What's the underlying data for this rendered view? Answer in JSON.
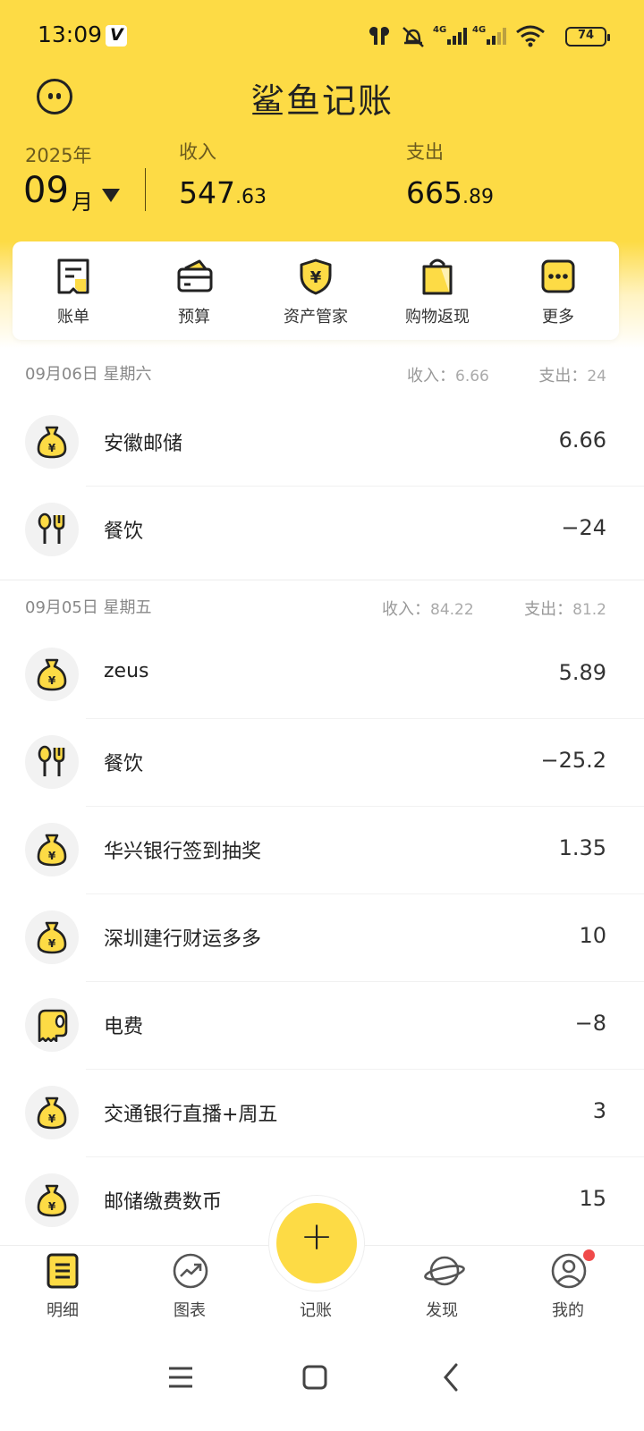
{
  "status_bar": {
    "time": "13:09",
    "app_badge": "V",
    "battery": "74"
  },
  "header": {
    "title": "鲨鱼记账",
    "year": "2025年",
    "month": "09",
    "month_unit": "月"
  },
  "summary": {
    "income_label": "收入",
    "income_int": "547",
    "income_dec": ".63",
    "expense_label": "支出",
    "expense_int": "665",
    "expense_dec": ".89"
  },
  "quick_menu": [
    {
      "label": "账单",
      "icon": "bill-icon"
    },
    {
      "label": "预算",
      "icon": "budget-wallet-icon"
    },
    {
      "label": "资产管家",
      "icon": "asset-shield-icon"
    },
    {
      "label": "购物返现",
      "icon": "shopping-bag-icon"
    },
    {
      "label": "更多",
      "icon": "more-icon"
    }
  ],
  "days": [
    {
      "date": "09月06日 星期六",
      "income_label": "收入：",
      "income": "6.66",
      "expense_label": "支出：",
      "expense": "24",
      "rows": [
        {
          "name": "安徽邮储",
          "amount": "6.66",
          "icon": "money-bag-icon"
        },
        {
          "name": "餐饮",
          "amount": "−24",
          "icon": "dining-icon"
        }
      ]
    },
    {
      "date": "09月05日 星期五",
      "income_label": "收入：",
      "income": "84.22",
      "expense_label": "支出：",
      "expense": "81.2",
      "rows": [
        {
          "name": "zeus",
          "amount": "5.89",
          "icon": "money-bag-icon"
        },
        {
          "name": "餐饮",
          "amount": "−25.2",
          "icon": "dining-icon"
        },
        {
          "name": "华兴银行签到抽奖",
          "amount": "1.35",
          "icon": "money-bag-icon"
        },
        {
          "name": "深圳建行财运多多",
          "amount": "10",
          "icon": "money-bag-icon"
        },
        {
          "name": "电费",
          "amount": "−8",
          "icon": "utility-icon"
        },
        {
          "name": "交通银行直播+周五",
          "amount": "3",
          "icon": "money-bag-icon"
        },
        {
          "name": "邮储缴费数币",
          "amount": "15",
          "icon": "money-bag-icon"
        }
      ]
    }
  ],
  "bottom_nav": {
    "detail": "明细",
    "chart": "图表",
    "add": "记账",
    "add_symbol": "+",
    "discover": "发现",
    "mine": "我的"
  },
  "colors": {
    "brand_yellow": "#fddb45",
    "notification_red": "#f04a4a"
  }
}
